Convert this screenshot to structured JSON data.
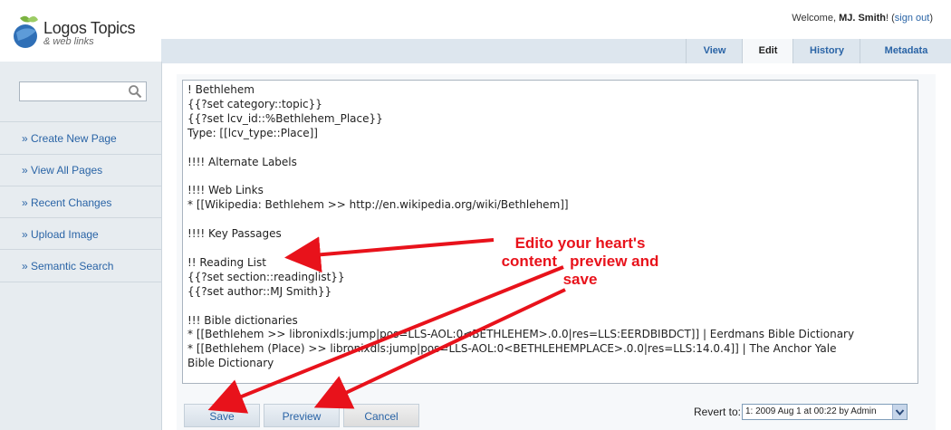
{
  "header": {
    "logo_title": "Logos Topics",
    "logo_subtitle": "& web links",
    "welcome_prefix": "Welcome, ",
    "user_name": "MJ. Smith",
    "welcome_suffix": "! (",
    "sign_out": "sign out",
    "close_paren": ")"
  },
  "tabs": [
    {
      "label": "View"
    },
    {
      "label": "Edit"
    },
    {
      "label": "History"
    },
    {
      "label": "Metadata"
    }
  ],
  "sidebar": {
    "search_placeholder": "",
    "items": [
      {
        "label": "» Create New Page"
      },
      {
        "label": "» View All Pages"
      },
      {
        "label": "» Recent Changes"
      },
      {
        "label": "» Upload Image"
      },
      {
        "label": "» Semantic Search"
      }
    ]
  },
  "editor": {
    "text": "! Bethlehem\n{{?set category::topic}}\n{{?set lcv_id::%Bethlehem_Place}}\nType: [[lcv_type::Place]]\n\n!!!! Alternate Labels\n\n!!!! Web Links\n* [[Wikipedia: Bethlehem >> http://en.wikipedia.org/wiki/Bethlehem]]\n\n!!!! Key Passages\n\n!! Reading List\n{{?set section::readinglist}}\n{{?set author::MJ Smith}}\n\n!!! Bible dictionaries\n* [[Bethlehem >> libronixdls:jump|pos=LLS-AOL:0<BETHLEHEM>.0.0|res=LLS:EERDBIBDCT]] | Eerdmans Bible Dictionary\n* [[Bethlehem (Place) >> libronixdls:jump|pos=LLS-AOL:0<BETHLEHEMPLACE>.0.0|res=LLS:14.0.4]] | The Anchor Yale\nBible Dictionary"
  },
  "buttons": {
    "save": "Save",
    "preview": "Preview",
    "cancel": "Cancel"
  },
  "revert": {
    "label": "Revert to:",
    "selected": "1: 2009 Aug 1 at 00:22 by Admin"
  },
  "annotation": {
    "line1": "Edito your heart's",
    "line2": "content   preview and",
    "line3": "save",
    "color": "#e8121b"
  },
  "colors": {
    "link": "#2a64a6",
    "sidebar_bg": "#e7ecf0",
    "tabbar_bg": "#dde6ee"
  }
}
